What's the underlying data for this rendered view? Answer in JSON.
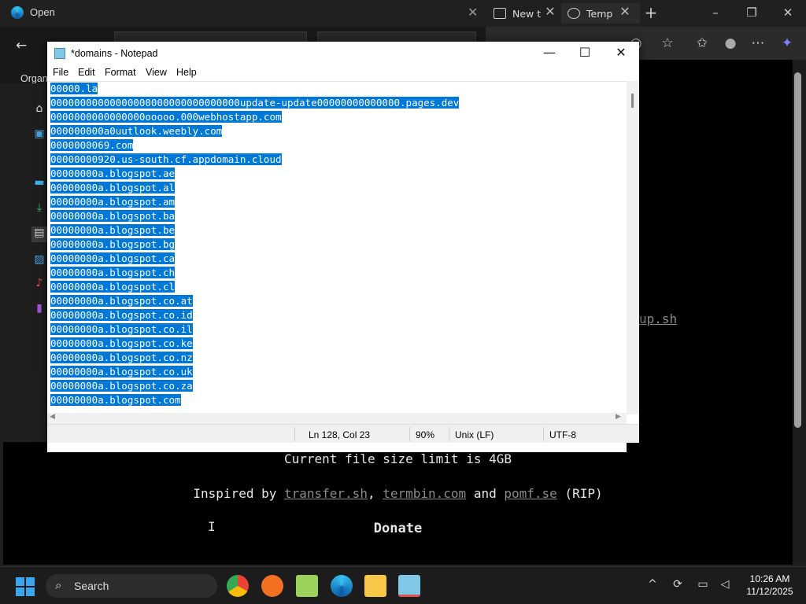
{
  "open_dialog": {
    "title": "Open",
    "organize_label": "Organ"
  },
  "browser": {
    "tabs": [
      {
        "label": "New t"
      },
      {
        "label": "Temp"
      }
    ],
    "page": {
      "partial_link": "up.sh",
      "file_size_text": "Current file size limit is 4GB",
      "inspired_prefix": "Inspired by ",
      "inspired_links": [
        "transfer.sh",
        "termbin.com",
        "pomf.se"
      ],
      "inspired_and": " and ",
      "inspired_comma": ", ",
      "inspired_suffix": " (RIP)",
      "donate_heading": "Donate"
    }
  },
  "notepad": {
    "title": "*domains - Notepad",
    "menu": [
      "File",
      "Edit",
      "Format",
      "View",
      "Help"
    ],
    "lines": [
      "00000.la",
      "00000000000000000000000000000000update-update00000000000000.pages.dev",
      "0000000000000000ooooo.000webhostapp.com",
      "000000000a0uutlook.weebly.com",
      "0000000069.com",
      "00000000920.us-south.cf.appdomain.cloud",
      "00000000a.blogspot.ae",
      "00000000a.blogspot.al",
      "00000000a.blogspot.am",
      "00000000a.blogspot.ba",
      "00000000a.blogspot.be",
      "00000000a.blogspot.bg",
      "00000000a.blogspot.ca",
      "00000000a.blogspot.ch",
      "00000000a.blogspot.cl",
      "00000000a.blogspot.co.at",
      "00000000a.blogspot.co.id",
      "00000000a.blogspot.co.il",
      "00000000a.blogspot.co.ke",
      "00000000a.blogspot.co.nz",
      "00000000a.blogspot.co.uk",
      "00000000a.blogspot.co.za",
      "00000000a.blogspot.com"
    ],
    "status": {
      "position": "Ln 128, Col 23",
      "zoom": "90%",
      "line_ending": "Unix (LF)",
      "encoding": "UTF-8"
    }
  },
  "taskbar": {
    "search_label": "Search",
    "time": "10:26 AM",
    "date": "11/12/2025"
  },
  "colors": {
    "selection": "#0078d7",
    "accent": "#0078d4"
  }
}
